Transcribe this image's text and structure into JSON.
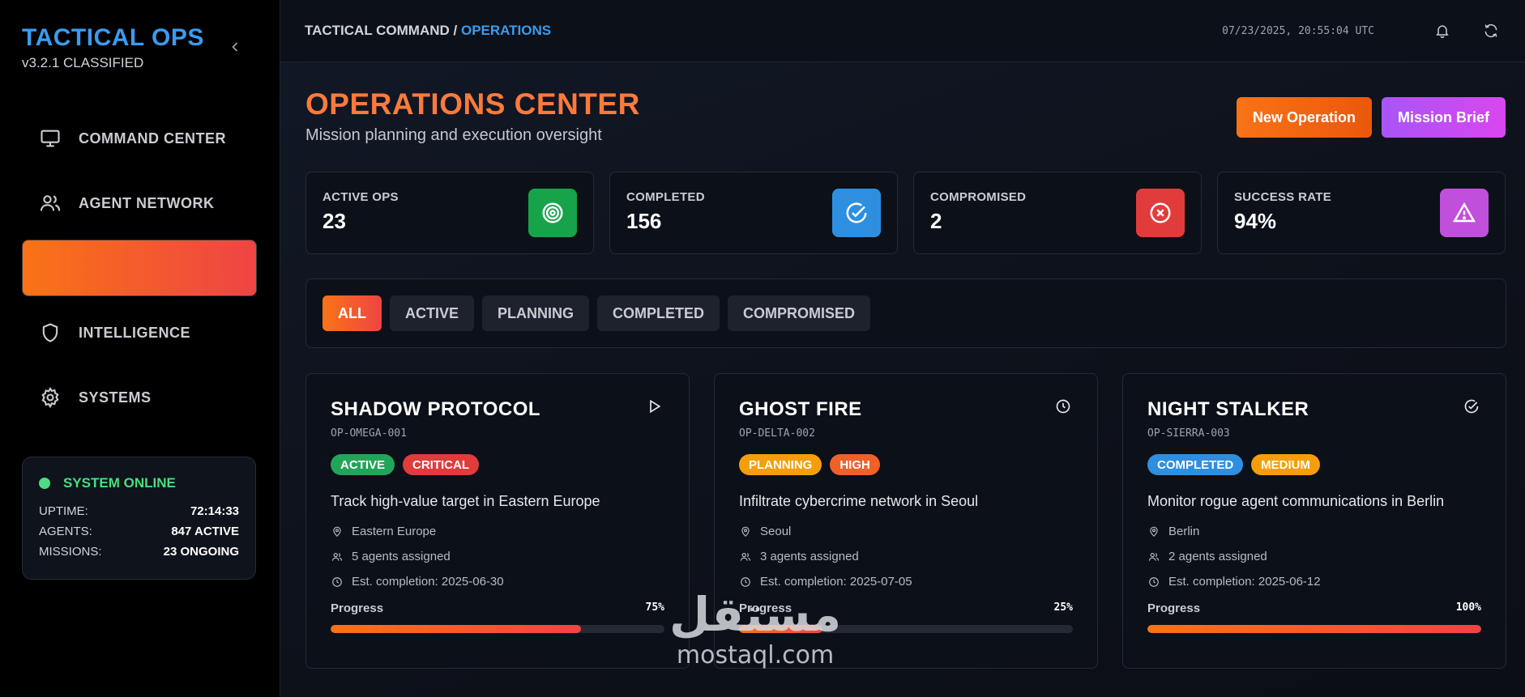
{
  "sidebar": {
    "brand_title": "TACTICAL OPS",
    "brand_version": "v3.2.1 CLASSIFIED",
    "nav": [
      {
        "label": "COMMAND CENTER",
        "icon": "monitor-icon"
      },
      {
        "label": "AGENT NETWORK",
        "icon": "users-icon"
      },
      {
        "label": "",
        "icon": "",
        "active": true
      },
      {
        "label": "INTELLIGENCE",
        "icon": "shield-icon"
      },
      {
        "label": "SYSTEMS",
        "icon": "gear-icon"
      }
    ],
    "status": {
      "title": "SYSTEM ONLINE",
      "rows": [
        {
          "k": "UPTIME:",
          "v": "72:14:33"
        },
        {
          "k": "AGENTS:",
          "v": "847 ACTIVE"
        },
        {
          "k": "MISSIONS:",
          "v": "23 ONGOING"
        }
      ]
    }
  },
  "topbar": {
    "breadcrumb_root": "TACTICAL COMMAND / ",
    "breadcrumb_current": "OPERATIONS",
    "timestamp": "07/23/2025, 20:55:04 UTC"
  },
  "header": {
    "title": "OPERATIONS CENTER",
    "subtitle": "Mission planning and execution oversight",
    "new_operation": "New Operation",
    "mission_brief": "Mission Brief"
  },
  "stats": [
    {
      "label": "ACTIVE OPS",
      "value": "23",
      "icon": "target-icon",
      "color": "#16a34a"
    },
    {
      "label": "COMPLETED",
      "value": "156",
      "icon": "check-circle-icon",
      "color": "#2e8fe0"
    },
    {
      "label": "COMPROMISED",
      "value": "2",
      "icon": "x-circle-icon",
      "color": "#e23b3b"
    },
    {
      "label": "SUCCESS RATE",
      "value": "94%",
      "icon": "warning-icon",
      "color": "#c04fdc"
    }
  ],
  "filters": [
    "ALL",
    "ACTIVE",
    "PLANNING",
    "COMPLETED",
    "COMPROMISED"
  ],
  "operations": [
    {
      "name": "SHADOW PROTOCOL",
      "code": "OP-OMEGA-001",
      "status": "ACTIVE",
      "status_color": "#22a55a",
      "priority": "CRITICAL",
      "priority_color": "#e23b3b",
      "description": "Track high-value target in Eastern Europe",
      "location": "Eastern Europe",
      "agents": "5 agents assigned",
      "eta": "Est. completion: 2025-06-30",
      "progress_label": "Progress",
      "progress_text": "75%",
      "progress": 0.75,
      "icon": "play-icon"
    },
    {
      "name": "GHOST FIRE",
      "code": "OP-DELTA-002",
      "status": "PLANNING",
      "status_color": "#f59e0b",
      "priority": "HIGH",
      "priority_color": "#f0612a",
      "description": "Infiltrate cybercrime network in Seoul",
      "location": "Seoul",
      "agents": "3 agents assigned",
      "eta": "Est. completion: 2025-07-05",
      "progress_label": "Progress",
      "progress_text": "25%",
      "progress": 0.25,
      "icon": "clock-icon"
    },
    {
      "name": "NIGHT STALKER",
      "code": "OP-SIERRA-003",
      "status": "COMPLETED",
      "status_color": "#2e8fe0",
      "priority": "MEDIUM",
      "priority_color": "#f59e0b",
      "description": "Monitor rogue agent communications in Berlin",
      "location": "Berlin",
      "agents": "2 agents assigned",
      "eta": "Est. completion: 2025-06-12",
      "progress_label": "Progress",
      "progress_text": "100%",
      "progress": 1.0,
      "icon": "check-circle-icon"
    }
  ],
  "watermark": {
    "arabic": "مستقل",
    "latin": "mostaql.com"
  }
}
